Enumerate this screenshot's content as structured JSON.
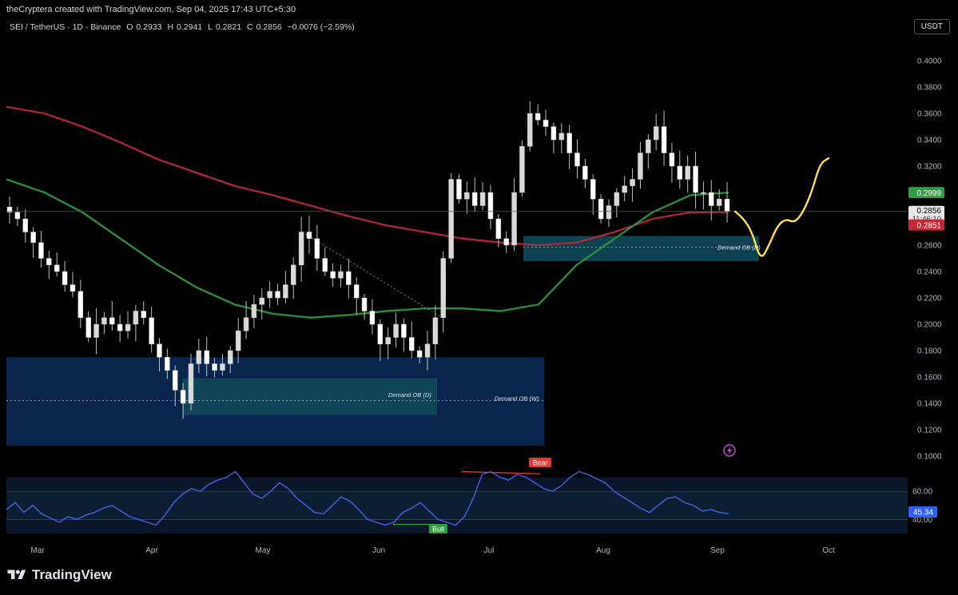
{
  "header": {
    "attribution": "theCryptera created with TradingView.com, Sep 04, 2025 17:43 UTC+5:30"
  },
  "legend": {
    "symbol": "SEI / TetherUS · 1D · Binance",
    "open_label": "O",
    "open": "0.2933",
    "high_label": "H",
    "high": "0.2941",
    "low_label": "L",
    "low": "0.2821",
    "close_label": "C",
    "close": "0.2856",
    "change": "−0.0076 (−2.59%)"
  },
  "currency_button": "USDT",
  "price_labels": {
    "ma_green": "0.2999",
    "last_price": "0.2856",
    "countdown": "11:46:10",
    "ma_red": "0.2851",
    "rsi_value": "45.34"
  },
  "annotations": {
    "demand_ob_d_upper": "Demand OB (D)",
    "demand_ob_d_lower": "Demand OB (D)",
    "demand_ob_w": "Demand OB (W)",
    "bear": "Bear",
    "bull": "Bull"
  },
  "footer": {
    "brand": "TradingView"
  },
  "colors": {
    "background": "#000000",
    "candle": "#d9d9d9",
    "ma_green": "#2e8b3e",
    "ma_red": "#a8283a",
    "rsi_line": "#3b5bdb",
    "projection": "#ffe14a",
    "zone_blue": "#0c2a5c",
    "zone_teal": "#0e4a5a"
  },
  "chart_data": {
    "type": "candlestick",
    "ylim": [
      0.1,
      0.41
    ],
    "y_ticks": [
      "0.4000",
      "0.3800",
      "0.3600",
      "0.3400",
      "0.3200",
      "0.3000",
      "0.2800",
      "0.2600",
      "0.2400",
      "0.2200",
      "0.2000",
      "0.1800",
      "0.1600",
      "0.1400",
      "0.1200",
      "0.1000"
    ],
    "x_ticks": [
      "Mar",
      "Apr",
      "May",
      "Jun",
      "Jul",
      "Aug",
      "Sep",
      "Oct"
    ],
    "close_path": [
      0.285,
      0.28,
      0.27,
      0.262,
      0.25,
      0.245,
      0.24,
      0.23,
      0.225,
      0.205,
      0.19,
      0.2,
      0.205,
      0.2,
      0.195,
      0.2,
      0.21,
      0.205,
      0.185,
      0.175,
      0.165,
      0.15,
      0.14,
      0.17,
      0.18,
      0.17,
      0.165,
      0.17,
      0.18,
      0.195,
      0.205,
      0.215,
      0.22,
      0.225,
      0.22,
      0.23,
      0.245,
      0.27,
      0.265,
      0.25,
      0.24,
      0.235,
      0.24,
      0.23,
      0.22,
      0.21,
      0.2,
      0.185,
      0.19,
      0.2,
      0.19,
      0.18,
      0.175,
      0.185,
      0.205,
      0.25,
      0.31,
      0.295,
      0.3,
      0.29,
      0.3,
      0.28,
      0.265,
      0.26,
      0.3,
      0.335,
      0.36,
      0.355,
      0.35,
      0.34,
      0.345,
      0.33,
      0.32,
      0.31,
      0.295,
      0.28,
      0.29,
      0.3,
      0.305,
      0.31,
      0.33,
      0.34,
      0.35,
      0.33,
      0.32,
      0.31,
      0.32,
      0.3,
      0.3,
      0.29,
      0.295,
      0.2856
    ],
    "ma200": [
      0.365,
      0.36,
      0.35,
      0.338,
      0.325,
      0.315,
      0.305,
      0.298,
      0.29,
      0.282,
      0.275,
      0.27,
      0.265,
      0.262,
      0.26,
      0.262,
      0.27,
      0.28,
      0.285,
      0.2851
    ],
    "ma50": [
      0.31,
      0.3,
      0.285,
      0.265,
      0.245,
      0.228,
      0.215,
      0.208,
      0.205,
      0.207,
      0.21,
      0.212,
      0.212,
      0.21,
      0.215,
      0.245,
      0.265,
      0.285,
      0.298,
      0.2999
    ],
    "projection": [
      0.2856,
      0.28,
      0.27,
      0.248,
      0.26,
      0.275,
      0.28,
      0.277,
      0.285,
      0.3,
      0.322,
      0.326
    ],
    "zones": [
      {
        "label": "Demand OB (W)",
        "low": 0.108,
        "high": 0.175
      },
      {
        "label": "Demand OB (D)",
        "low": 0.131,
        "high": 0.159
      },
      {
        "label": "Demand OB (D)",
        "low": 0.248,
        "high": 0.267
      }
    ],
    "rsi": {
      "levels": [
        60.0,
        40.0
      ],
      "last": 45.34,
      "values": [
        47,
        52,
        45,
        50,
        44,
        41,
        38,
        42,
        40,
        43,
        45,
        48,
        50,
        46,
        42,
        40,
        38,
        36,
        43,
        52,
        58,
        62,
        60,
        65,
        68,
        70,
        74,
        66,
        58,
        55,
        60,
        66,
        62,
        55,
        50,
        45,
        44,
        50,
        56,
        53,
        47,
        40,
        38,
        36,
        38,
        45,
        48,
        52,
        46,
        40,
        38,
        36,
        42,
        55,
        72,
        74,
        70,
        68,
        72,
        70,
        66,
        62,
        60,
        64,
        70,
        74,
        72,
        69,
        66,
        60,
        56,
        52,
        48,
        45,
        50,
        55,
        56,
        52,
        50,
        46,
        47,
        45,
        44
      ]
    }
  }
}
